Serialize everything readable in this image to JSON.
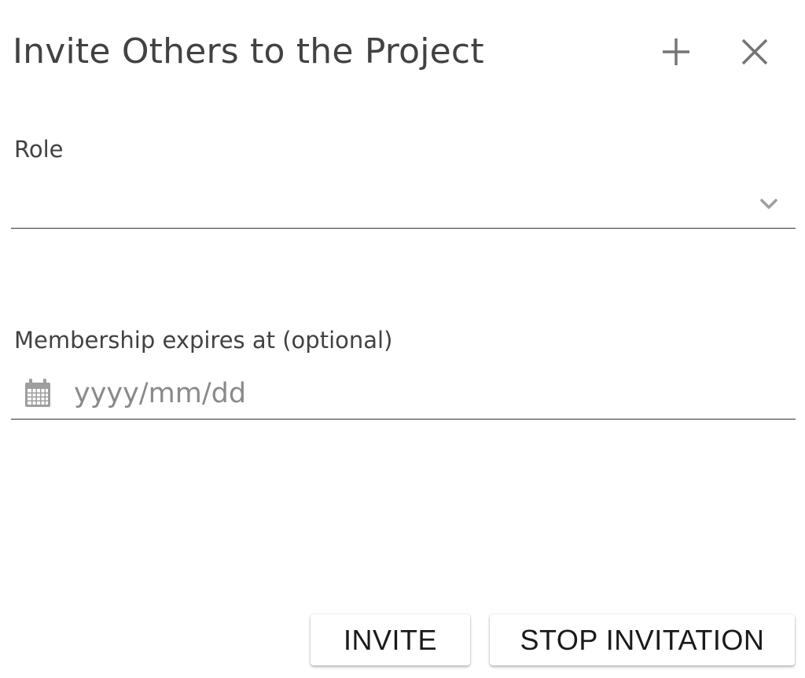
{
  "dialog": {
    "title": "Invite Others to the Project",
    "add_icon": "plus-icon",
    "close_icon": "close-icon"
  },
  "role": {
    "label": "Role",
    "value": "",
    "dropdown_icon": "chevron-down-icon"
  },
  "expiry": {
    "label": "Membership expires at (optional)",
    "placeholder": "yyyy/mm/dd",
    "value": "",
    "icon": "calendar-icon"
  },
  "actions": {
    "invite_label": "INVITE",
    "stop_label": "STOP INVITATION"
  },
  "colors": {
    "text": "#424242",
    "icon": "#757575",
    "underline": "#333333",
    "placeholder": "#8a8a8a"
  }
}
